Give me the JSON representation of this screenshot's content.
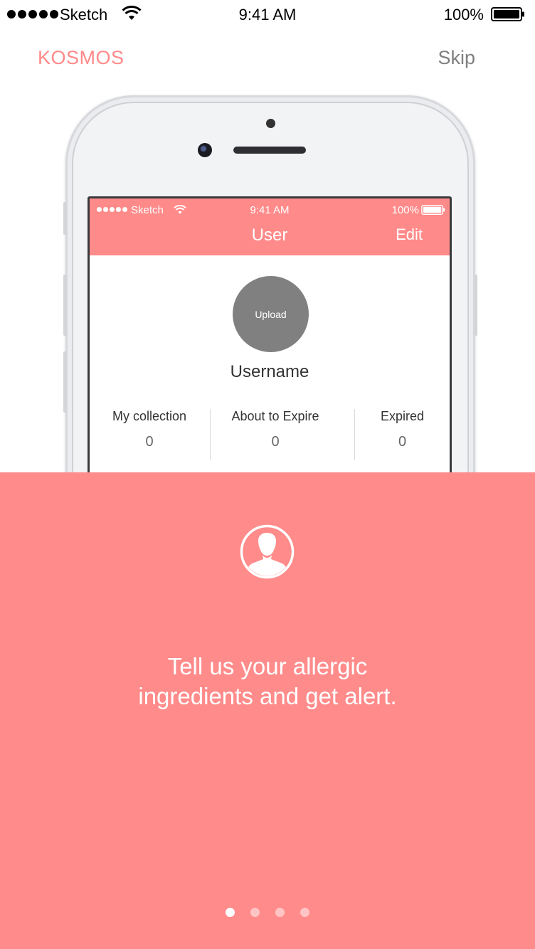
{
  "status_bar": {
    "carrier": "Sketch",
    "time": "9:41 AM",
    "battery_percent": "100%"
  },
  "header": {
    "app_title": "KOSMOS",
    "skip_label": "Skip"
  },
  "mockup_screen": {
    "status_bar": {
      "carrier": "Sketch",
      "time": "9:41 AM",
      "battery_percent": "100%"
    },
    "nav_title": "User",
    "edit_label": "Edit",
    "avatar_upload_label": "Upload",
    "username": "Username",
    "stats": [
      {
        "label": "My collection",
        "value": "0"
      },
      {
        "label": "About to Expire",
        "value": "0"
      },
      {
        "label": "Expired",
        "value": "0"
      }
    ]
  },
  "onboarding": {
    "icon": "user-profile-icon",
    "tagline_line1": "Tell us your allergic",
    "tagline_line2": "ingredients and get alert.",
    "page_count": 4,
    "active_page": 1
  },
  "colors": {
    "accent": "#ff8a8a",
    "panel": "#ff8b8b",
    "skip_text": "#7f7f7f",
    "avatar": "#808080"
  }
}
